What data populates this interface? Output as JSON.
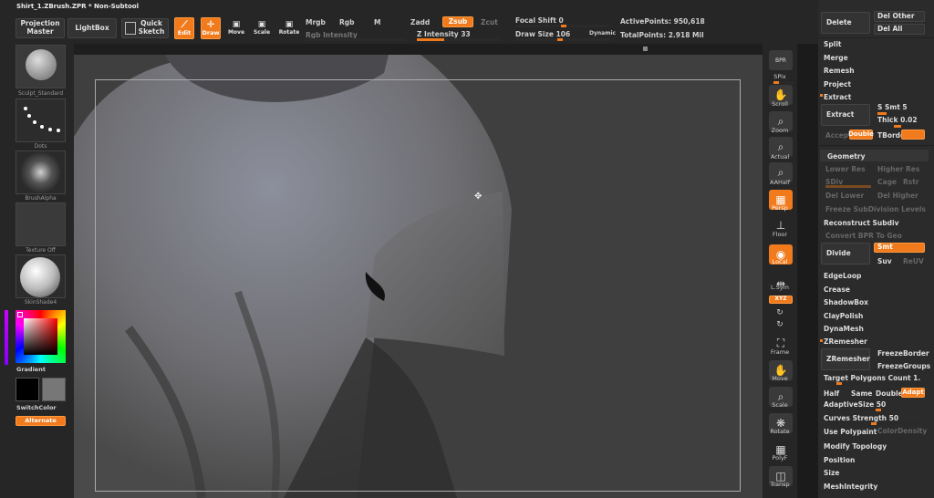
{
  "header": {
    "file_title": "Shirt_1.ZBrush.ZPR  * Non-Subtool"
  },
  "toolbar": {
    "projection_master": "Projection Master",
    "lightbox": "LightBox",
    "quick_sketch": "Quick Sketch",
    "edit": "Edit",
    "draw": "Draw",
    "move": "Move",
    "scale": "Scale",
    "rotate": "Rotate",
    "mrgb": "Mrgb",
    "rgb": "Rgb",
    "m": "M",
    "rgb_intensity": "Rgb Intensity",
    "zadd": "Zadd",
    "zsub": "Zsub",
    "zcut": "Zcut",
    "z_intensity_label": "Z Intensity",
    "z_intensity_value": "33",
    "z_intensity_level": 0.33,
    "focal_shift_label": "Focal Shift",
    "focal_shift_value": "0",
    "draw_size_label": "Draw Size",
    "draw_size_value": "106",
    "dynamic": "Dynamic",
    "active_points": "ActivePoints: 950,618",
    "total_points": "TotalPoints: 2.918 Mil"
  },
  "left": {
    "standard": "Sculpt_Standard",
    "dots": "Dots",
    "brush_alpha": "BrushAlpha",
    "texture": "Texture Off",
    "material": "SkinShade4",
    "gradient": "Gradient",
    "switch_color": "SwitchColor",
    "alternate": "Alternate",
    "accent": "#f07a1c"
  },
  "right_toolbar": {
    "bpr": "BPR",
    "spix": "SPix",
    "scroll": "Scroll",
    "zoom": "Zoom",
    "actual": "Actual",
    "aahalf": "AAHalf",
    "persp": "Persp",
    "floor": "Floor",
    "local": "Local",
    "lsym": "L.Sym",
    "xyz": "XYZ",
    "frame": "Frame",
    "move": "Move",
    "scale": "Scale",
    "rotate": "Rotate",
    "polyf": "PolyF",
    "transp": "Transp"
  },
  "right_panel": {
    "delete": "Delete",
    "del_other": "Del Other",
    "del_all": "Del All",
    "split": "Split",
    "merge": "Merge",
    "remesh": "Remesh",
    "project": "Project",
    "extract_section": "Extract",
    "extract_btn": "Extract",
    "s_smt": "S Smt 5",
    "thick": "Thick 0.02",
    "accept": "Accept",
    "double": "Double",
    "tborder": "TBorder",
    "geometry": "Geometry",
    "lower_res": "Lower Res",
    "higher_res": "Higher Res",
    "sdiv": "SDiv",
    "cage": "Cage",
    "rstr": "Rstr",
    "del_lower": "Del Lower",
    "del_higher": "Del Higher",
    "freeze_subdiv": "Freeze SubDivision Levels",
    "reconstruct": "Reconstruct Subdiv",
    "convert_bpr": "Convert BPR To Geo",
    "divide": "Divide",
    "smt": "Smt",
    "suv": "Suv",
    "reuv": "ReUV",
    "edgeloop": "EdgeLoop",
    "crease": "Crease",
    "shadowbox": "ShadowBox",
    "claypolish": "ClayPolish",
    "dynamesh": "DynaMesh",
    "zremesher_section": "ZRemesher",
    "zremesher_btn": "ZRemesher",
    "freeze_border": "FreezeBorder",
    "freeze_groups": "FreezeGroups",
    "target_polys": "Target Polygons Count 1.",
    "half": "Half",
    "same": "Same",
    "double2": "Double",
    "adapt": "Adapt",
    "adaptive_size": "AdaptiveSize 50",
    "curves_strength": "Curves Strength 50",
    "use_polypaint": "Use Polypaint",
    "color_density": "ColorDensity",
    "modify_topology": "Modify Topology",
    "position": "Position",
    "size": "Size",
    "meshintegrity": "MeshIntegrity"
  }
}
